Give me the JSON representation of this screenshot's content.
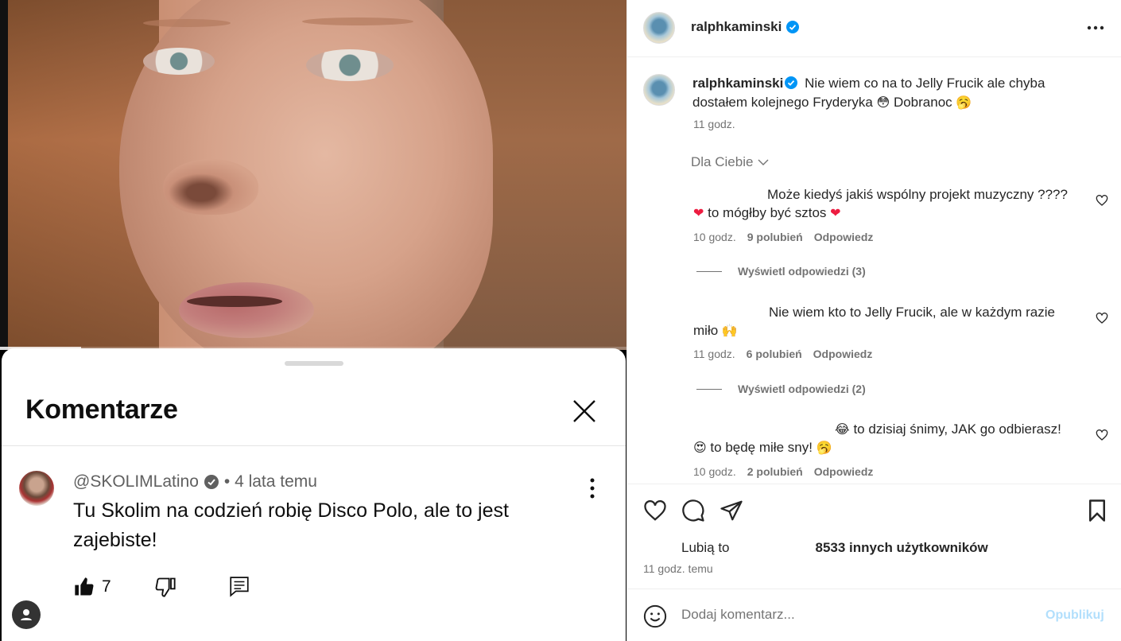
{
  "youtube": {
    "title": "Komentarze",
    "comment": {
      "author": "@SKOLIMLatino",
      "time": "• 4 lata temu",
      "text": "Tu Skolim na codzień robię Disco Polo, ale to jest zajebiste!",
      "likes": "7"
    },
    "progress": 0.13
  },
  "instagram": {
    "username": "ralphkaminski",
    "caption": {
      "username": "ralphkaminski",
      "text_a": "Nie wiem co na to Jelly Frucik ale chyba dostałem kolejnego Fryderyka",
      "emoji_a": "😳",
      "text_b": "Dobranoc",
      "emoji_b": "🥱",
      "time": "11 godz."
    },
    "sort_label": "Dla Ciebie",
    "comments": [
      {
        "line1": "Może kiedyś jakiś wspólny projekt muzyczny ????",
        "line2_heart_a": "❤",
        "line2": "to mógłby być sztos",
        "line2_heart_b": "❤",
        "time": "10 godz.",
        "likes": "9 polubień",
        "reply": "Odpowiedz",
        "view_replies": "Wyświetl odpowiedzi (3)"
      },
      {
        "line1": "Nie wiem kto to Jelly Frucik, ale w każdym razie",
        "line2": "miło",
        "line2_emoji": "🙌",
        "time": "11 godz.",
        "likes": "6 polubień",
        "reply": "Odpowiedz",
        "view_replies": "Wyświetl odpowiedzi (2)"
      },
      {
        "line1_emoji": "😂",
        "line1": "to dzisiaj śnimy, JAK go odbierasz!",
        "line2_emoji": "😍",
        "line2": "to będę miłe sny!",
        "line2_emoji_b": "🥱",
        "time": "10 godz.",
        "likes": "2 polubień",
        "reply": "Odpowiedz"
      }
    ],
    "likes_prefix": "Lubią to",
    "likes_count": "8533 innych użytkowników",
    "post_time": "11 godz. temu",
    "add_comment_placeholder": "Dodaj komentarz...",
    "publish_label": "Opublikuj"
  }
}
